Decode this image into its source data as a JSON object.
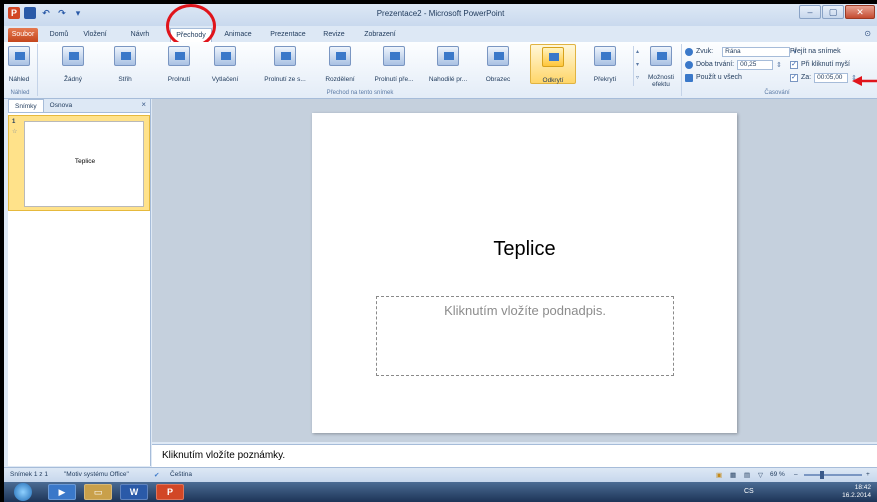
{
  "titlebar": {
    "title": "Prezentace2 - Microsoft PowerPoint"
  },
  "qat": {
    "logo": "P",
    "undo": "↶",
    "redo": "↷",
    "more": "▾"
  },
  "window": {
    "minimize": "–",
    "maximize": "▢",
    "close": "✕"
  },
  "tabs": {
    "file": "Soubor",
    "items": [
      "Domů",
      "Vložení",
      "Návrh",
      "Přechody",
      "Animace",
      "Prezentace",
      "Revize",
      "Zobrazení"
    ],
    "active": "Přechody"
  },
  "ribbon": {
    "preview": "Náhled",
    "preview_group": "Náhled",
    "transitions": [
      "Žádný",
      "Střih",
      "Prolnutí",
      "Vytlačení",
      "Prolnutí ze s...",
      "Rozdělení",
      "Prolnutí pře...",
      "Nahodilé pr...",
      "Obrazec",
      "Odkrytí",
      "Překrytí"
    ],
    "selected_transition": "Odkrytí",
    "effect_options": "Možnosti efektu",
    "transitions_group": "Přechod na tento snímek",
    "sound_label": "Zvuk:",
    "sound_value": "Rána",
    "duration_label": "Doba trvání:",
    "duration_value": "00,25",
    "apply_all": "Použít u všech",
    "advance_label": "Přejít na snímek",
    "on_click": "Při kliknutí myší",
    "after_label": "Za:",
    "after_value": "00:05,00",
    "timing_group": "Časování"
  },
  "leftpanel": {
    "tabs": [
      "Snímky",
      "Osnova"
    ],
    "close": "×",
    "thumb_num": "1",
    "thumb_star": "☆",
    "thumb_title": "Teplice"
  },
  "slide": {
    "title": "Teplice",
    "subtitle_placeholder": "Kliknutím vložíte podnadpis."
  },
  "notes": {
    "placeholder": "Kliknutím vložíte poznámky."
  },
  "statusbar": {
    "slide_count": "Snímek 1 z 1",
    "theme": "\"Motiv systému Office\"",
    "language": "Čeština",
    "zoom": "69 %",
    "zoom_out": "–",
    "zoom_in": "+"
  },
  "taskbar": {
    "lang": "CS",
    "time": "18:42",
    "date": "16.2.2014",
    "word": "W",
    "ppt": "P"
  },
  "colors": {
    "accent": "#d24726",
    "highlight": "#e0141b",
    "ribbon": "#dfe9f5"
  }
}
